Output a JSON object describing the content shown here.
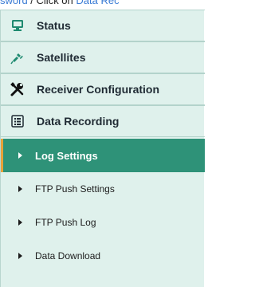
{
  "header_fragment": {
    "link1": "sword",
    "text": " / Click on ",
    "link2": "Data Rec"
  },
  "menu": {
    "sections": [
      {
        "label": "Status",
        "icon": "status-monitor-icon"
      },
      {
        "label": "Satellites",
        "icon": "satellite-icon"
      },
      {
        "label": "Receiver Configuration",
        "icon": "tools-icon"
      },
      {
        "label": "Data Recording",
        "icon": "list-document-icon"
      }
    ],
    "subitems": [
      {
        "label": "Log Settings",
        "active": true
      },
      {
        "label": "FTP Push Settings",
        "active": false
      },
      {
        "label": "FTP Push Log",
        "active": false
      },
      {
        "label": "Data Download",
        "active": false
      }
    ]
  },
  "colors": {
    "menu_background": "#dff1ec",
    "active_background": "#2e9278",
    "active_accent": "#e7a23a",
    "link": "#3a7bd5",
    "icon_green": "#1f8a70"
  }
}
